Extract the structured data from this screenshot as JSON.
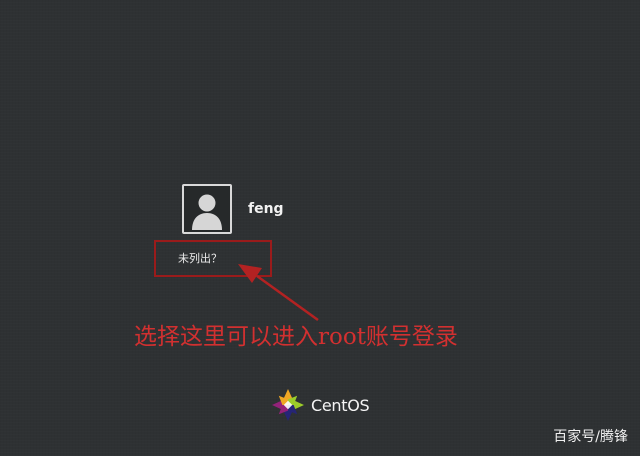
{
  "login": {
    "user_name": "feng",
    "not_listed_label": "未列出？"
  },
  "annotation": {
    "text": "选择这里可以进入root账号登录",
    "color": "#d23030",
    "box_color": "#9a1b1b"
  },
  "branding": {
    "name": "CentOS"
  },
  "watermark": {
    "text": "百家号/腾锋"
  },
  "icons": {
    "avatar": "user-silhouette-icon",
    "logo": "centos-logo-icon",
    "arrow": "annotation-arrow"
  }
}
